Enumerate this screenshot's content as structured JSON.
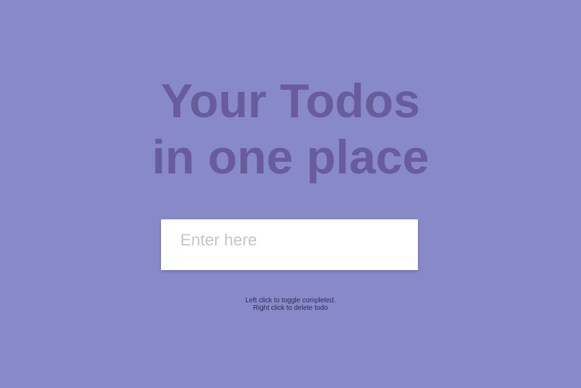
{
  "header": {
    "title_line1": "Your Todos",
    "title_line2": "in one place"
  },
  "todo_input": {
    "placeholder": "Enter here",
    "value": ""
  },
  "hints": {
    "line1": "Left click to toggle completed.",
    "line2": "Right click to delete todo"
  },
  "todos": [],
  "colors": {
    "background": "#8889c8",
    "heading": "#685c9c",
    "input_background": "#ffffff",
    "placeholder": "#c6c6c6",
    "hint_text": "#2c2a57"
  }
}
